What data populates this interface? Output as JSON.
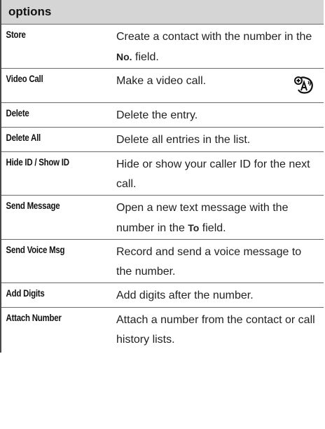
{
  "table": {
    "header": "options",
    "rows": [
      {
        "option": "Store",
        "desc_before": "Create a contact with the number in the ",
        "desc_bold": "No.",
        "desc_after": " field."
      },
      {
        "option": "Video Call",
        "desc": "Make a video call.",
        "icon": "network-dependent-feature-icon"
      },
      {
        "option": "Delete",
        "desc": "Delete the entry."
      },
      {
        "option": "Delete All",
        "desc": "Delete all entries in the list."
      },
      {
        "option": "Hide ID / Show ID",
        "desc": "Hide or show your caller ID for the next call."
      },
      {
        "option": "Send Message",
        "desc_before": "Open a new text message with the number in the ",
        "desc_bold": "To",
        "desc_after": " field."
      },
      {
        "option": "Send Voice Msg",
        "desc": "Record and send a voice message to the number."
      },
      {
        "option": "Add Digits",
        "desc": "Add digits after the number."
      },
      {
        "option": "Attach Number",
        "desc": "Attach a number from the contact or call history lists."
      }
    ]
  }
}
